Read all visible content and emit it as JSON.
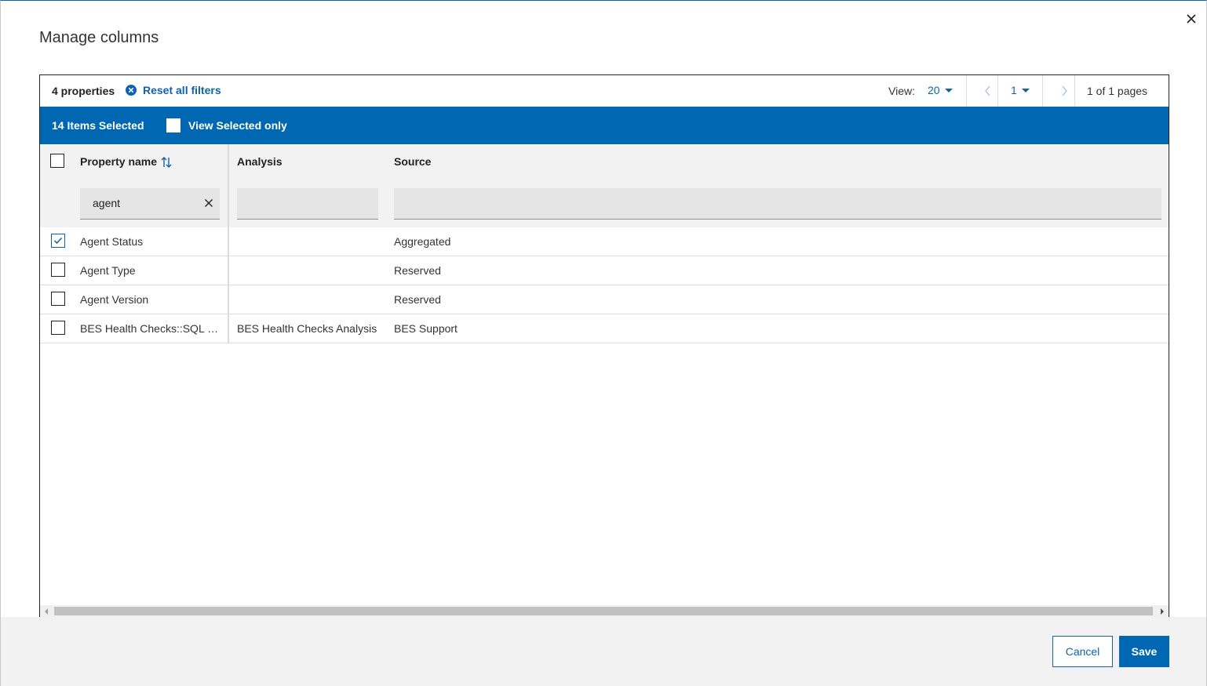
{
  "dialog": {
    "title": "Manage columns",
    "close_icon": "close-icon"
  },
  "toolbar": {
    "properties_count": "4 properties",
    "reset_filters_label": "Reset all filters",
    "view_label": "View:",
    "view_value": "20",
    "page_value": "1",
    "pages_info": "1 of 1 pages"
  },
  "selection": {
    "items_selected": "14 Items Selected",
    "view_selected_label": "View Selected only",
    "view_selected_checked": false
  },
  "table": {
    "columns": [
      {
        "label": "Property name",
        "filter_value": "agent"
      },
      {
        "label": "Analysis",
        "filter_value": ""
      },
      {
        "label": "Source",
        "filter_value": ""
      }
    ],
    "rows": [
      {
        "checked": true,
        "property": "Agent Status",
        "analysis": "",
        "source": "Aggregated"
      },
      {
        "checked": false,
        "property": "Agent Type",
        "analysis": "",
        "source": "Reserved"
      },
      {
        "checked": false,
        "property": "Agent Version",
        "analysis": "",
        "source": "Reserved"
      },
      {
        "checked": false,
        "property": "BES Health Checks::SQL S...",
        "analysis": "BES Health Checks Analysis",
        "source": "BES Support"
      }
    ]
  },
  "footer": {
    "cancel_label": "Cancel",
    "save_label": "Save"
  },
  "colors": {
    "accent": "#0068b3",
    "link": "#0f62ae"
  }
}
